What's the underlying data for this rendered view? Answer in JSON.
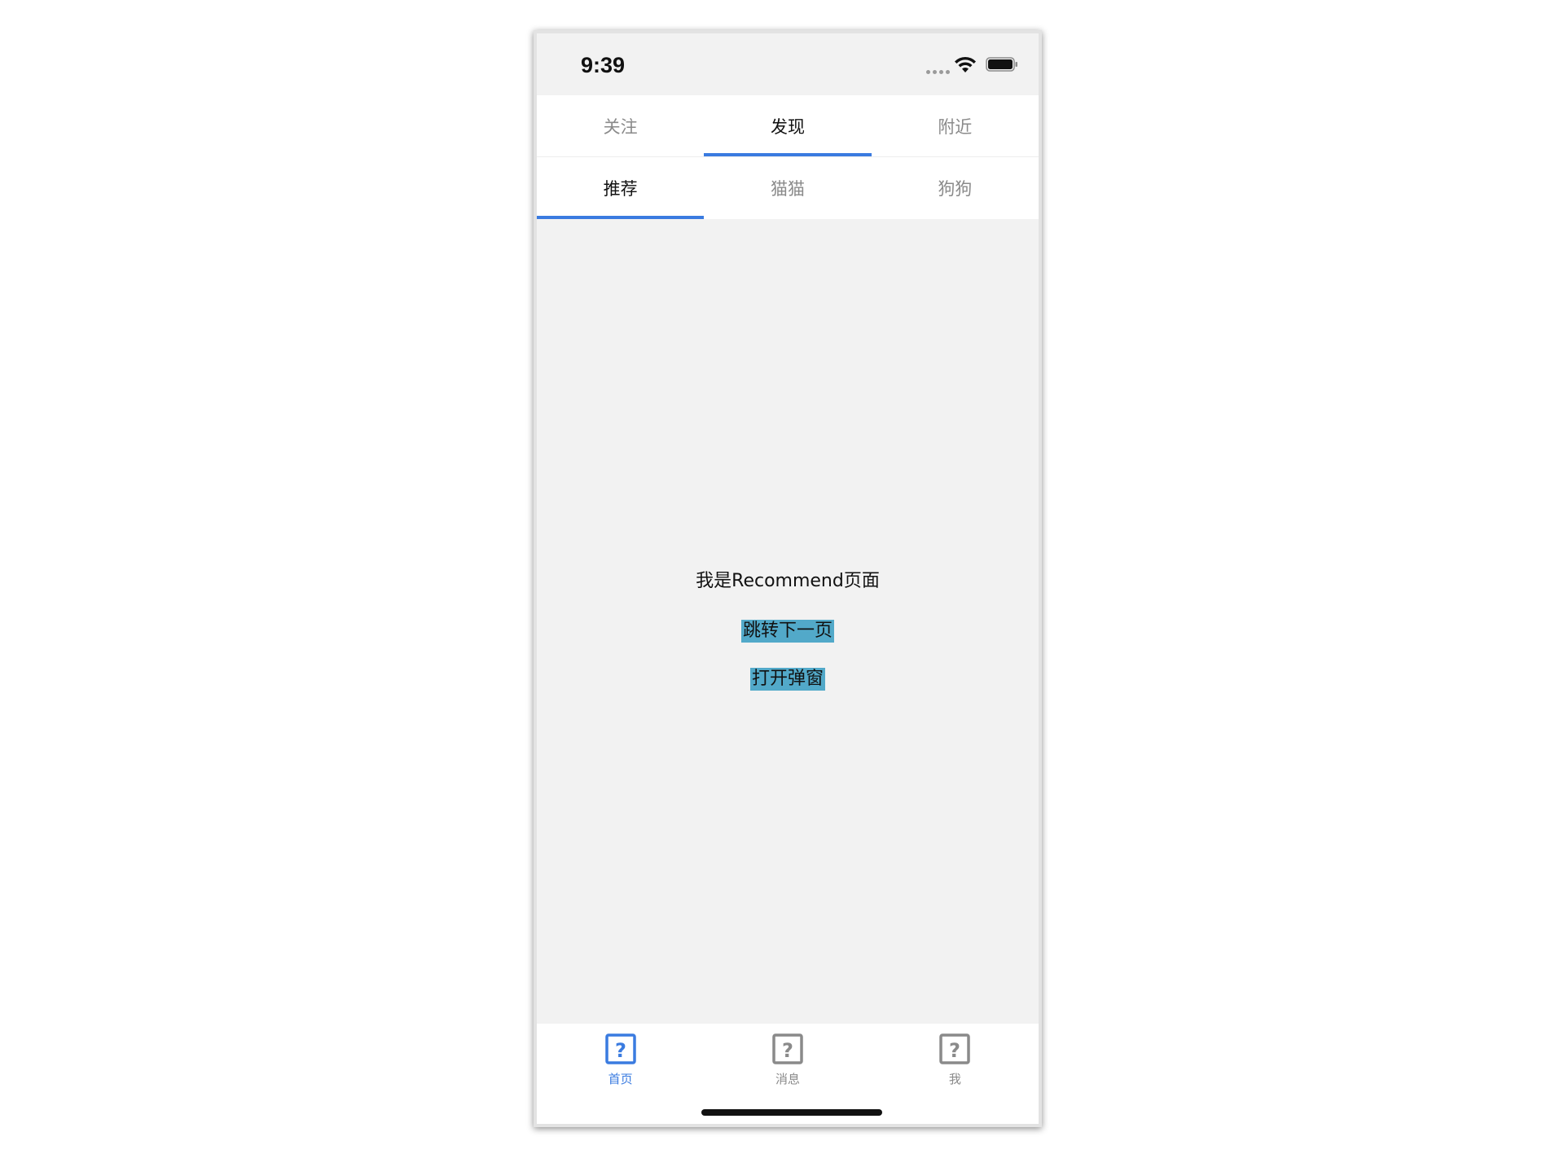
{
  "status_bar": {
    "time": "9:39"
  },
  "top_tabs": [
    {
      "label": "关注",
      "active": false
    },
    {
      "label": "发现",
      "active": true
    },
    {
      "label": "附近",
      "active": false
    }
  ],
  "sub_tabs": [
    {
      "label": "推荐",
      "active": true
    },
    {
      "label": "猫猫",
      "active": false
    },
    {
      "label": "狗狗",
      "active": false
    }
  ],
  "main": {
    "page_text": "我是Recommend页面",
    "next_page_button": "跳转下一页",
    "open_popup_button": "打开弹窗"
  },
  "tab_bar": [
    {
      "label": "首页",
      "icon": "question-icon",
      "active": true
    },
    {
      "label": "消息",
      "icon": "question-icon",
      "active": false
    },
    {
      "label": "我",
      "icon": "question-icon",
      "active": false
    }
  ],
  "colors": {
    "accent": "#3a7be0",
    "button_bg": "#52a9c9",
    "background": "#f2f2f2"
  }
}
